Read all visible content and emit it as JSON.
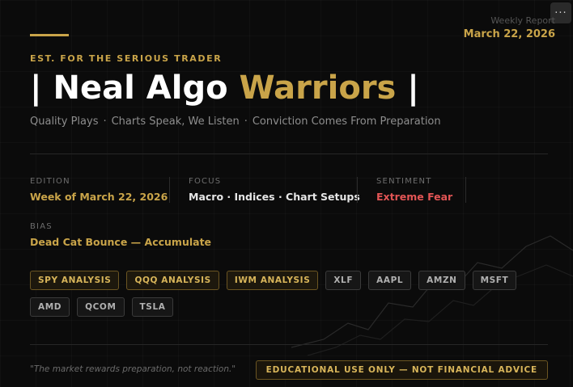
{
  "menu": {
    "icon": "more-dots-icon",
    "glyph": "···"
  },
  "report": {
    "label": "Weekly Report",
    "date": "March 22, 2026"
  },
  "tagline": "EST. FOR THE SERIOUS TRADER",
  "title": {
    "prefix": "| Neal Algo ",
    "highlight": "Warriors",
    "suffix": " |"
  },
  "subtitle": {
    "parts": [
      "Quality Plays",
      "Charts Speak, We Listen",
      "Conviction Comes From Preparation"
    ],
    "separator": "·"
  },
  "meta": {
    "edition": {
      "label": "EDITION",
      "value": "Week of March 22, 2026"
    },
    "focus": {
      "label": "FOCUS",
      "value": "Macro · Indices · Chart Setups"
    },
    "sentiment": {
      "label": "SENTIMENT",
      "value": "Extreme Fear"
    },
    "bias": {
      "label": "BIAS",
      "value": "Dead Cat Bounce — Accumulate"
    }
  },
  "tags": [
    {
      "label": "SPY ANALYSIS",
      "style": "gold"
    },
    {
      "label": "QQQ ANALYSIS",
      "style": "gold"
    },
    {
      "label": "IWM ANALYSIS",
      "style": "gold"
    },
    {
      "label": "XLF",
      "style": "plain"
    },
    {
      "label": "AAPL",
      "style": "plain"
    },
    {
      "label": "AMZN",
      "style": "plain"
    },
    {
      "label": "MSFT",
      "style": "plain"
    },
    {
      "label": "AMD",
      "style": "plain"
    },
    {
      "label": "QCOM",
      "style": "plain"
    },
    {
      "label": "TSLA",
      "style": "plain"
    }
  ],
  "footer": {
    "quote": "\"The market rewards preparation, not reaction.\"",
    "disclaimer": "EDUCATIONAL USE ONLY — NOT FINANCIAL ADVICE"
  },
  "colors": {
    "accent": "#c9a449",
    "danger": "#e25555",
    "background": "#0b0b0b"
  }
}
